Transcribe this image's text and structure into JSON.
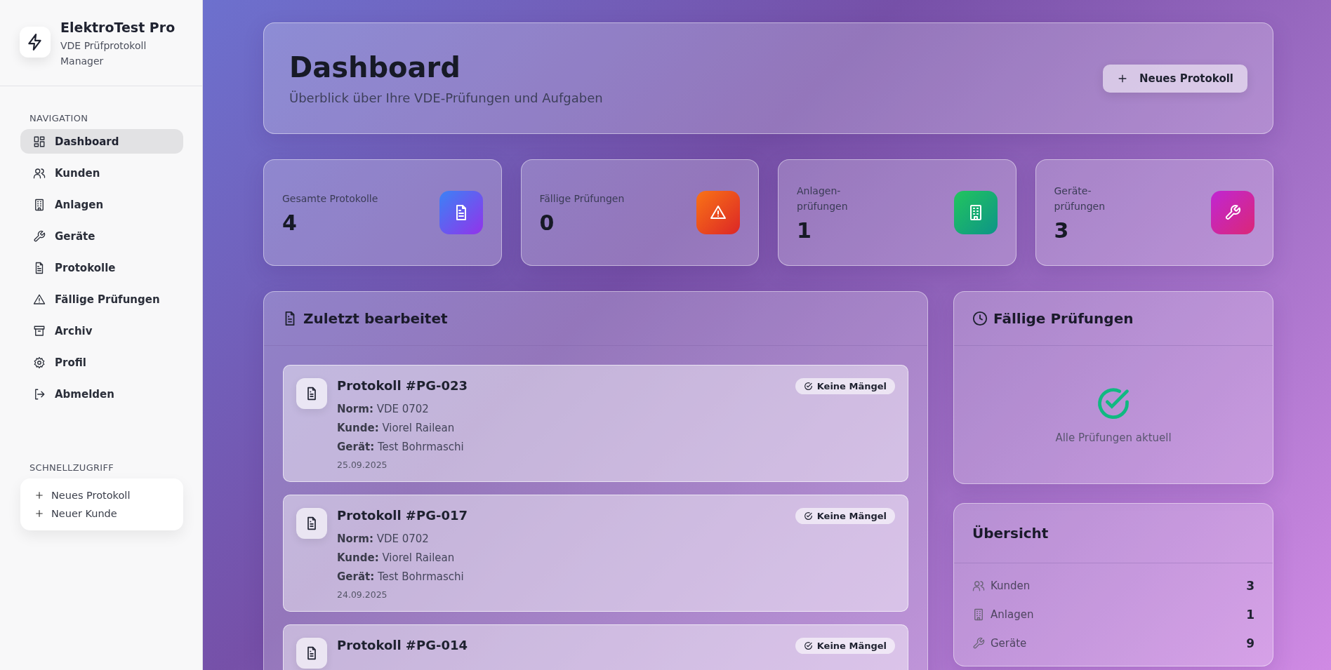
{
  "brand": {
    "title": "ElektroTest Pro",
    "subtitle": "VDE Prüfprotokoll Manager"
  },
  "sidebar": {
    "section_label": "NAVIGATION",
    "items": [
      {
        "label": "Dashboard",
        "selected": true
      },
      {
        "label": "Kunden",
        "selected": false
      },
      {
        "label": "Anlagen",
        "selected": false
      },
      {
        "label": "Geräte",
        "selected": false
      },
      {
        "label": "Protokolle",
        "selected": false
      },
      {
        "label": "Fällige Prüfungen",
        "selected": false
      },
      {
        "label": "Archiv",
        "selected": false
      },
      {
        "label": "Profil",
        "selected": false
      },
      {
        "label": "Abmelden",
        "selected": false
      }
    ],
    "quick_label": "SCHNELLZUGRIFF",
    "quick_links": [
      "Neues Protokoll",
      "Neuer Kunde"
    ]
  },
  "header": {
    "title": "Dashboard",
    "subtitle": "Überblick über Ihre VDE-Prüfungen und Aufgaben",
    "button": "Neues Protokoll"
  },
  "stats": [
    {
      "label": "Gesamte Protokolle",
      "value": "4"
    },
    {
      "label": "Fällige Prüfungen",
      "value": "0"
    },
    {
      "label": "Anlagen-\nprüfungen",
      "value": "1"
    },
    {
      "label": "Geräte-\nprüfungen",
      "value": "3"
    }
  ],
  "recent": {
    "title": "Zuletzt bearbeitet",
    "items": [
      {
        "title": "Protokoll #PG-023",
        "badge": "Keine Mängel",
        "fields": [
          {
            "label": "Norm:",
            "value": "VDE 0702"
          },
          {
            "label": "Kunde:",
            "value": "Viorel Railean"
          },
          {
            "label": "Gerät:",
            "value": "Test Bohrmaschi"
          }
        ],
        "date": "25.09.2025"
      },
      {
        "title": "Protokoll #PG-017",
        "badge": "Keine Mängel",
        "fields": [
          {
            "label": "Norm:",
            "value": "VDE 0702"
          },
          {
            "label": "Kunde:",
            "value": "Viorel Railean"
          },
          {
            "label": "Gerät:",
            "value": "Test Bohrmaschi"
          }
        ],
        "date": "24.09.2025"
      },
      {
        "title": "Protokoll #PG-014",
        "badge": "Keine Mängel"
      }
    ]
  },
  "due": {
    "title": "Fällige Prüfungen",
    "message": "Alle Prüfungen aktuell"
  },
  "overview": {
    "title": "Übersicht",
    "rows": [
      {
        "label": "Kunden",
        "value": "3"
      },
      {
        "label": "Anlagen",
        "value": "1"
      },
      {
        "label": "Geräte",
        "value": "9"
      }
    ]
  }
}
